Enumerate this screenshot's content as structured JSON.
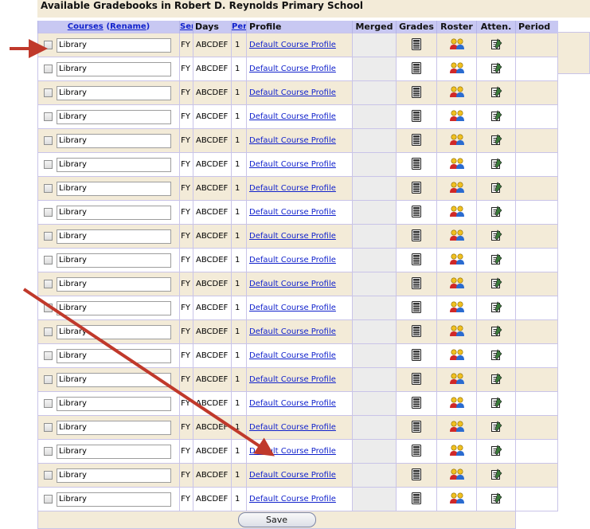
{
  "page_title": "Available Gradebooks in Robert D. Reynolds Primary School",
  "headers": {
    "courses_link": "Courses",
    "rename_open": "(",
    "rename_link": "Rename",
    "rename_close": ")",
    "sem_link": "Sem",
    "days": "Days",
    "per_link": "Per.",
    "profile": "Profile",
    "merged": "Merged",
    "grades": "Grades",
    "roster": "Roster",
    "atten": "Atten.",
    "period": "Period"
  },
  "rows": [
    {
      "course": "Library",
      "sem": "FY",
      "days": "ABCDEF",
      "per": "1",
      "profile": "Default Course Profile"
    },
    {
      "course": "Library",
      "sem": "FY",
      "days": "ABCDEF",
      "per": "1",
      "profile": "Default Course Profile"
    },
    {
      "course": "Library",
      "sem": "FY",
      "days": "ABCDEF",
      "per": "1",
      "profile": "Default Course Profile"
    },
    {
      "course": "Library",
      "sem": "FY",
      "days": "ABCDEF",
      "per": "1",
      "profile": "Default Course Profile"
    },
    {
      "course": "Library",
      "sem": "FY",
      "days": "ABCDEF",
      "per": "1",
      "profile": "Default Course Profile"
    },
    {
      "course": "Library",
      "sem": "FY",
      "days": "ABCDEF",
      "per": "1",
      "profile": "Default Course Profile"
    },
    {
      "course": "Library",
      "sem": "FY",
      "days": "ABCDEF",
      "per": "1",
      "profile": "Default Course Profile"
    },
    {
      "course": "Library",
      "sem": "FY",
      "days": "ABCDEF",
      "per": "1",
      "profile": "Default Course Profile"
    },
    {
      "course": "Library",
      "sem": "FY",
      "days": "ABCDEF",
      "per": "1",
      "profile": "Default Course Profile"
    },
    {
      "course": "Library",
      "sem": "FY",
      "days": "ABCDEF",
      "per": "1",
      "profile": "Default Course Profile"
    },
    {
      "course": "Library",
      "sem": "FY",
      "days": "ABCDEF",
      "per": "1",
      "profile": "Default Course Profile"
    },
    {
      "course": "Library",
      "sem": "FY",
      "days": "ABCDEF",
      "per": "1",
      "profile": "Default Course Profile"
    },
    {
      "course": "Library",
      "sem": "FY",
      "days": "ABCDEF",
      "per": "1",
      "profile": "Default Course Profile"
    },
    {
      "course": "Library",
      "sem": "FY",
      "days": "ABCDEF",
      "per": "1",
      "profile": "Default Course Profile"
    },
    {
      "course": "Library",
      "sem": "FY",
      "days": "ABCDEF",
      "per": "1",
      "profile": "Default Course Profile"
    },
    {
      "course": "Library",
      "sem": "FY",
      "days": "ABCDEF",
      "per": "1",
      "profile": "Default Course Profile"
    },
    {
      "course": "Library",
      "sem": "FY",
      "days": "ABCDEF",
      "per": "1",
      "profile": "Default Course Profile"
    },
    {
      "course": "Library",
      "sem": "FY",
      "days": "ABCDEF",
      "per": "1",
      "profile": "Default Course Profile"
    },
    {
      "course": "Library",
      "sem": "FY",
      "days": "ABCDEF",
      "per": "1",
      "profile": "Default Course Profile"
    },
    {
      "course": "Library",
      "sem": "FY",
      "days": "ABCDEF",
      "per": "1",
      "profile": "Default Course Profile"
    }
  ],
  "icons": {
    "grades": "gradebook-icon",
    "roster": "roster-people-icon",
    "atten": "attendance-icon"
  },
  "save_label": "Save",
  "colors": {
    "header_bg": "#c8c8f2",
    "row_odd_bg": "#f3ebd8",
    "merged_bg": "#ececec",
    "link": "#1122cc",
    "annotation_arrow": "#c0392b"
  }
}
